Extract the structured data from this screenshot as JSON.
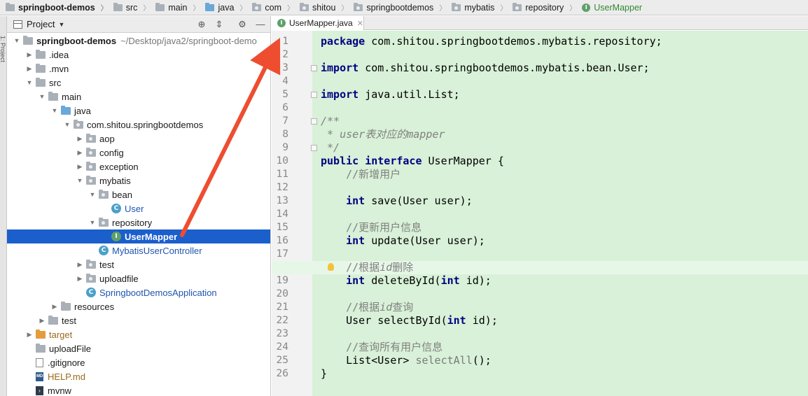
{
  "breadcrumb": [
    {
      "label": "springboot-demos",
      "icon": "folder-icon",
      "bold": true
    },
    {
      "label": "src",
      "icon": "folder-icon"
    },
    {
      "label": "main",
      "icon": "folder-icon"
    },
    {
      "label": "java",
      "icon": "source-folder-icon"
    },
    {
      "label": "com",
      "icon": "package-icon"
    },
    {
      "label": "shitou",
      "icon": "package-icon"
    },
    {
      "label": "springbootdemos",
      "icon": "package-icon"
    },
    {
      "label": "mybatis",
      "icon": "package-icon"
    },
    {
      "label": "repository",
      "icon": "package-icon"
    },
    {
      "label": "UserMapper",
      "icon": "interface-icon",
      "color": "#2f8a2f"
    }
  ],
  "left_strip_label": "1: Project",
  "project_panel": {
    "title": "Project",
    "tree": [
      {
        "label": "springboot-demos",
        "path": "~/Desktop/java2/springboot-demo",
        "depth": 0,
        "arrow": "open",
        "icon": "folder",
        "bold": true
      },
      {
        "label": ".idea",
        "depth": 1,
        "arrow": "closed",
        "icon": "folder"
      },
      {
        "label": ".mvn",
        "depth": 1,
        "arrow": "closed",
        "icon": "folder"
      },
      {
        "label": "src",
        "depth": 1,
        "arrow": "open",
        "icon": "folder"
      },
      {
        "label": "main",
        "depth": 2,
        "arrow": "open",
        "icon": "folder"
      },
      {
        "label": "java",
        "depth": 3,
        "arrow": "open",
        "icon": "folder-blue"
      },
      {
        "label": "com.shitou.springbootdemos",
        "depth": 4,
        "arrow": "open",
        "icon": "package"
      },
      {
        "label": "aop",
        "depth": 5,
        "arrow": "closed",
        "icon": "package"
      },
      {
        "label": "config",
        "depth": 5,
        "arrow": "closed",
        "icon": "package"
      },
      {
        "label": "exception",
        "depth": 5,
        "arrow": "closed",
        "icon": "package"
      },
      {
        "label": "mybatis",
        "depth": 5,
        "arrow": "open",
        "icon": "package"
      },
      {
        "label": "bean",
        "depth": 6,
        "arrow": "open",
        "icon": "package"
      },
      {
        "label": "User",
        "depth": 7,
        "arrow": "none",
        "icon": "class",
        "style": "blue"
      },
      {
        "label": "repository",
        "depth": 6,
        "arrow": "open",
        "icon": "package"
      },
      {
        "label": "UserMapper",
        "depth": 7,
        "arrow": "none",
        "icon": "interface",
        "selected": true
      },
      {
        "label": "MybatisUserController",
        "depth": 6,
        "arrow": "none",
        "icon": "class",
        "style": "blue"
      },
      {
        "label": "test",
        "depth": 5,
        "arrow": "closed",
        "icon": "package"
      },
      {
        "label": "uploadfile",
        "depth": 5,
        "arrow": "closed",
        "icon": "package"
      },
      {
        "label": "SpringbootDemosApplication",
        "depth": 5,
        "arrow": "none",
        "icon": "class",
        "style": "blue"
      },
      {
        "label": "resources",
        "depth": 3,
        "arrow": "closed",
        "icon": "folder-res"
      },
      {
        "label": "test",
        "depth": 2,
        "arrow": "closed",
        "icon": "folder"
      },
      {
        "label": "target",
        "depth": 1,
        "arrow": "closed",
        "icon": "folder-orange",
        "style": "orange"
      },
      {
        "label": "uploadFile",
        "depth": 1,
        "arrow": "none",
        "icon": "folder"
      },
      {
        "label": ".gitignore",
        "depth": 1,
        "arrow": "none",
        "icon": "file"
      },
      {
        "label": "HELP.md",
        "depth": 1,
        "arrow": "none",
        "icon": "file-md",
        "style": "orange"
      },
      {
        "label": "mvnw",
        "depth": 1,
        "arrow": "none",
        "icon": "file-term"
      }
    ]
  },
  "editor": {
    "tab_label": "UserMapper.java",
    "current_line": 18,
    "lines": [
      [
        {
          "t": "package",
          "c": "kw"
        },
        {
          "t": " com.shitou.springbootdemos.mybatis.repository;"
        }
      ],
      [],
      [
        {
          "t": "import",
          "c": "kw"
        },
        {
          "t": " com.shitou.springbootdemos.mybatis.bean.User;"
        }
      ],
      [],
      [
        {
          "t": "import",
          "c": "kw"
        },
        {
          "t": " java.util.List;"
        }
      ],
      [],
      [
        {
          "t": "/**",
          "c": "cm"
        }
      ],
      [
        {
          "t": " * ",
          "c": "cm"
        },
        {
          "t": "user",
          "c": "cm"
        },
        {
          "t": "表对应的",
          "c": "cm"
        },
        {
          "t": "mapper",
          "c": "cm"
        }
      ],
      [
        {
          "t": " */",
          "c": "cm"
        }
      ],
      [
        {
          "t": "public",
          "c": "kw"
        },
        {
          "t": " "
        },
        {
          "t": "interface",
          "c": "kw"
        },
        {
          "t": " UserMapper {"
        }
      ],
      [
        {
          "t": "    //新增用户",
          "c": "cmn"
        }
      ],
      [],
      [
        {
          "t": "    "
        },
        {
          "t": "int",
          "c": "kw"
        },
        {
          "t": " save(User user);"
        }
      ],
      [],
      [
        {
          "t": "    //更新用户信息",
          "c": "cmn"
        }
      ],
      [
        {
          "t": "    "
        },
        {
          "t": "int",
          "c": "kw"
        },
        {
          "t": " update(User user);"
        }
      ],
      [],
      [
        {
          "t": "    //根据",
          "c": "cmn"
        },
        {
          "t": "id",
          "c": "cmi"
        },
        {
          "t": "删除",
          "c": "cmn"
        }
      ],
      [
        {
          "t": "    "
        },
        {
          "t": "int",
          "c": "kw"
        },
        {
          "t": " deleteById("
        },
        {
          "t": "int",
          "c": "kw"
        },
        {
          "t": " id);"
        }
      ],
      [],
      [
        {
          "t": "    //根据",
          "c": "cmn"
        },
        {
          "t": "id",
          "c": "cmi"
        },
        {
          "t": "查询",
          "c": "cmn"
        }
      ],
      [
        {
          "t": "    User selectById("
        },
        {
          "t": "int",
          "c": "kw"
        },
        {
          "t": " id);"
        }
      ],
      [],
      [
        {
          "t": "    //查询所有用户信息",
          "c": "cmn"
        }
      ],
      [
        {
          "t": "    List<User> "
        },
        {
          "t": "selectAll",
          "c": "mcall"
        },
        {
          "t": "();"
        }
      ],
      [
        {
          "t": "}"
        }
      ]
    ]
  },
  "colors": {
    "selection": "#1b5fcc",
    "code_background": "#d8f1d8",
    "annotation_arrow": "#ee4d30"
  }
}
